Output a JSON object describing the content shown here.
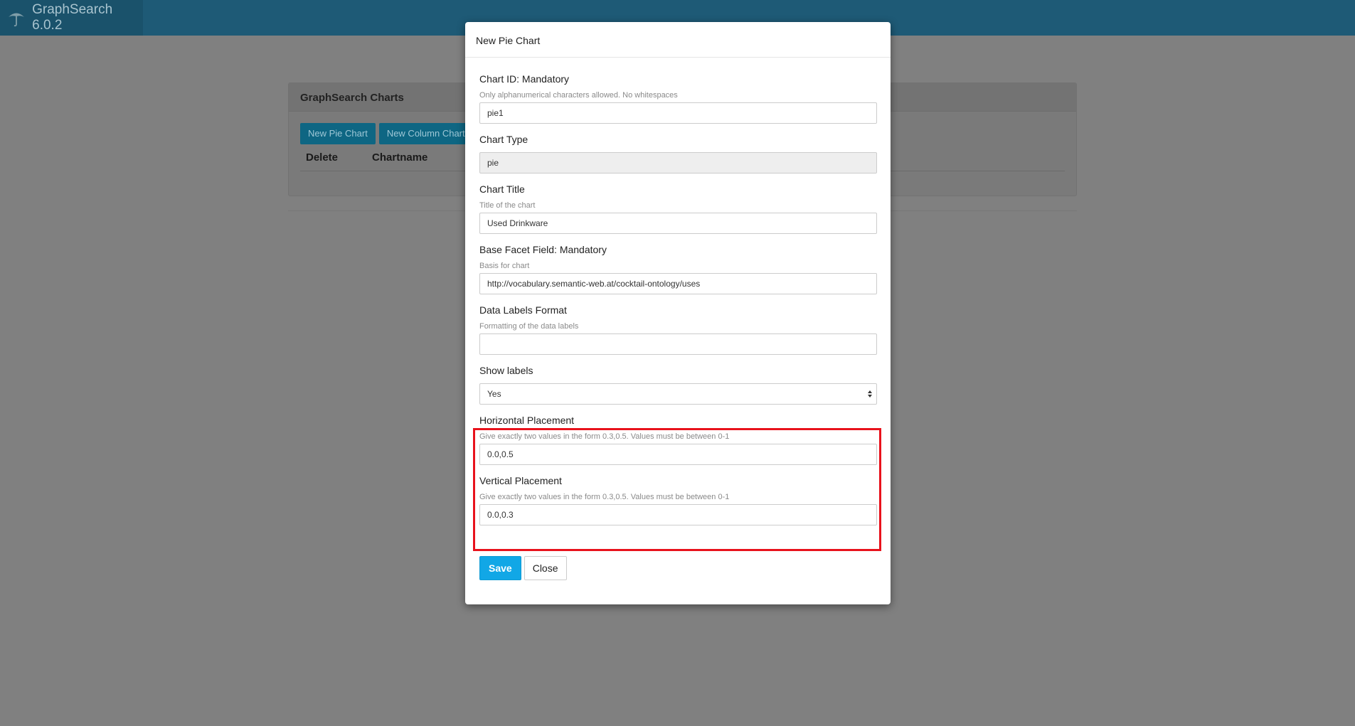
{
  "app": {
    "title": "GraphSearch 6.0.2",
    "icon": "umbrella-icon"
  },
  "background": {
    "panel_title": "GraphSearch Charts",
    "buttons": [
      "New Pie Chart",
      "New Column Chart"
    ],
    "columns": [
      "Delete",
      "Chartname"
    ]
  },
  "modal": {
    "title": "New Pie Chart",
    "fields": {
      "chart_id": {
        "label": "Chart ID: Mandatory",
        "help": "Only alphanumerical characters allowed. No whitespaces",
        "value": "pie1"
      },
      "chart_type": {
        "label": "Chart Type",
        "value": "pie"
      },
      "chart_title": {
        "label": "Chart Title",
        "help": "Title of the chart",
        "value": "Used Drinkware"
      },
      "base_facet": {
        "label": "Base Facet Field: Mandatory",
        "help": "Basis for chart",
        "value": "http://vocabulary.semantic-web.at/cocktail-ontology/uses"
      },
      "data_labels": {
        "label": "Data Labels Format",
        "help": "Formatting of the data labels",
        "value": ""
      },
      "show_labels": {
        "label": "Show labels",
        "value": "Yes"
      },
      "horizontal": {
        "label": "Horizontal Placement",
        "help": "Give exactly two values in the form 0.3,0.5. Values must be between 0-1",
        "value": "0.0,0.5"
      },
      "vertical": {
        "label": "Vertical Placement",
        "help": "Give exactly two values in the form 0.3,0.5. Values must be between 0-1",
        "value": "0.0,0.3"
      }
    },
    "save_label": "Save",
    "close_label": "Close"
  },
  "colors": {
    "highlight": "#e8121c",
    "primary": "#11a7e6",
    "navbar": "#1e5a76"
  }
}
